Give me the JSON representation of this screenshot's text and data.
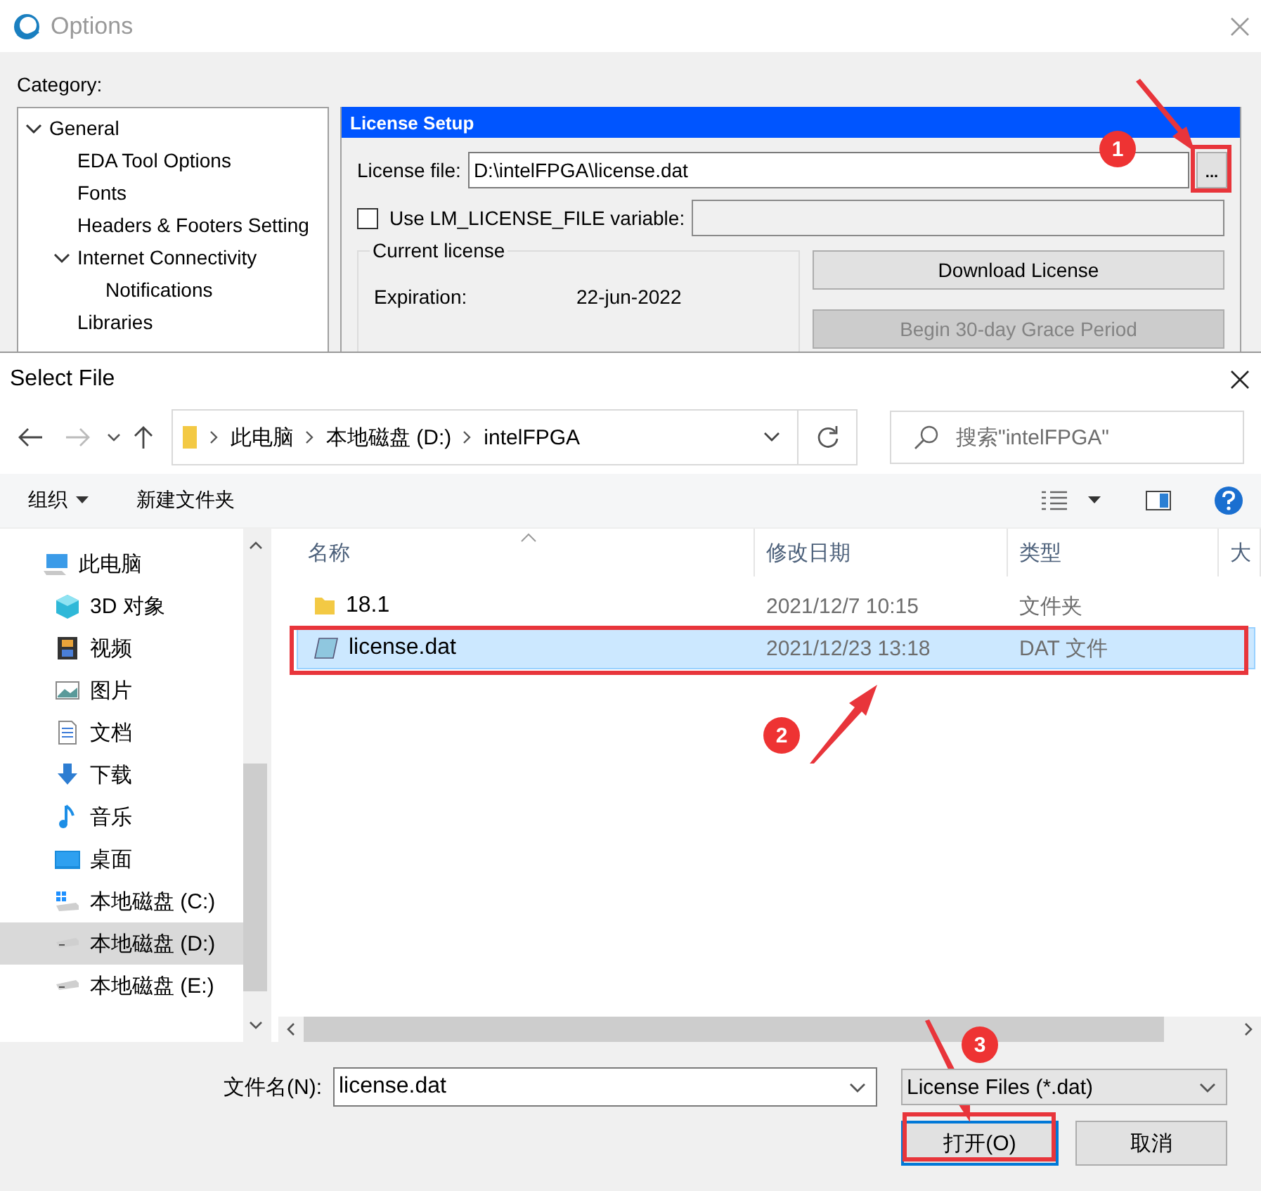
{
  "options_window": {
    "title": "Options",
    "category_label": "Category:",
    "tree": [
      {
        "label": "General",
        "expanded": true,
        "children": [
          {
            "label": "EDA Tool Options"
          },
          {
            "label": "Fonts"
          },
          {
            "label": "Headers & Footers Setting"
          },
          {
            "label": "Internet Connectivity",
            "expanded": true,
            "children": [
              {
                "label": "Notifications"
              }
            ]
          },
          {
            "label": "Libraries"
          }
        ]
      }
    ],
    "panel": {
      "title": "License Setup",
      "license_file_label": "License file:",
      "license_file_value": "D:\\intelFPGA\\license.dat",
      "browse_button": "...",
      "use_env_label": "Use LM_LICENSE_FILE variable:",
      "use_env_checked": false,
      "current_license_title": "Current license",
      "fields": [
        {
          "label": "Expiration:",
          "value": "22-jun-2022"
        }
      ],
      "buttons": [
        {
          "label": "Download License",
          "disabled": false
        },
        {
          "label": "Begin 30-day Grace Period",
          "disabled": true
        }
      ]
    }
  },
  "file_dialog": {
    "title": "Select File",
    "breadcrumb": [
      "此电脑",
      "本地磁盘 (D:)",
      "intelFPGA"
    ],
    "search_placeholder": "搜索\"intelFPGA\"",
    "toolbar": [
      {
        "label": "组织",
        "dropdown": true
      },
      {
        "label": "新建文件夹",
        "dropdown": false
      }
    ],
    "nav": [
      {
        "label": "此电脑",
        "kind": "computer",
        "selected": false,
        "children": [
          {
            "label": "3D 对象",
            "kind": "objects",
            "selected": false
          },
          {
            "label": "视频",
            "kind": "videos",
            "selected": false
          },
          {
            "label": "图片",
            "kind": "pictures",
            "selected": false
          },
          {
            "label": "文档",
            "kind": "documents",
            "selected": false
          },
          {
            "label": "下载",
            "kind": "downloads",
            "selected": false
          },
          {
            "label": "音乐",
            "kind": "music",
            "selected": false
          },
          {
            "label": "桌面",
            "kind": "desktop",
            "selected": false
          },
          {
            "label": "本地磁盘 (C:)",
            "kind": "systemdrive",
            "selected": false
          },
          {
            "label": "本地磁盘 (D:)",
            "kind": "drive",
            "selected": true
          },
          {
            "label": "本地磁盘 (E:)",
            "kind": "drive",
            "selected": false
          }
        ]
      }
    ],
    "columns": [
      "名称",
      "修改日期",
      "类型",
      "大"
    ],
    "files": [
      {
        "name": "18.1",
        "modified": "2021/12/7 10:15",
        "type": "文件夹",
        "kind": "folder",
        "selected": false
      },
      {
        "name": "license.dat",
        "modified": "2021/12/23 13:18",
        "type": "DAT 文件",
        "kind": "file",
        "selected": true
      }
    ],
    "filename_label": "文件名(N):",
    "filename_value": "license.dat",
    "filter": "License Files (*.dat)",
    "buttons": [
      {
        "label": "打开(O)",
        "kind": "primary"
      },
      {
        "label": "取消",
        "kind": "normal"
      }
    ]
  },
  "annotations": [
    {
      "label": "1"
    },
    {
      "label": "2"
    },
    {
      "label": "3"
    }
  ]
}
